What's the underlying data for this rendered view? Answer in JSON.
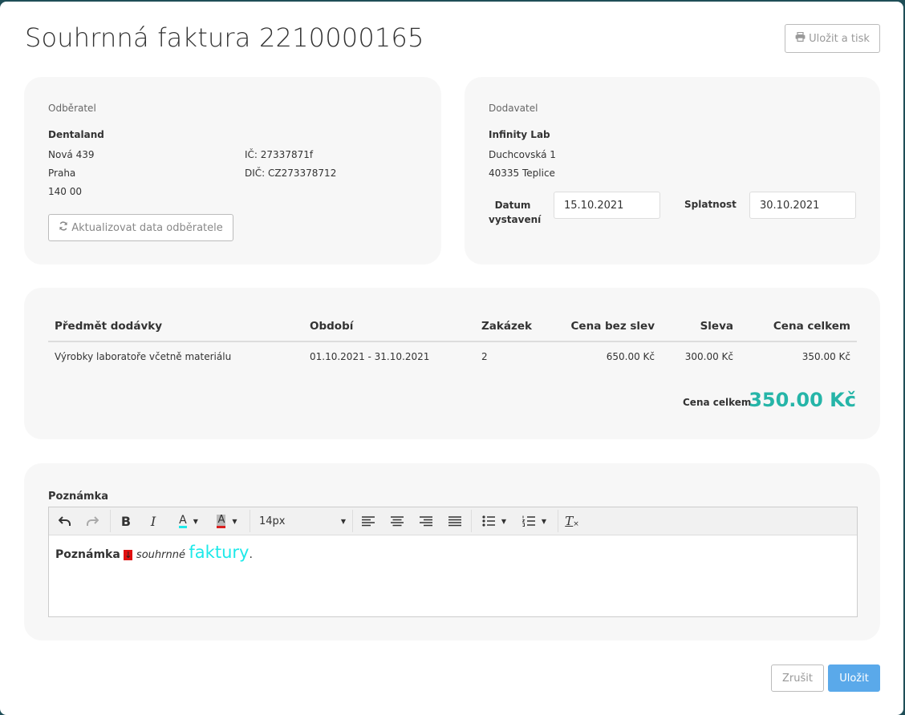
{
  "title": "Souhrnná faktura 2210000165",
  "header": {
    "print_save_label": "Uložit a tisk",
    "print_icon": "print-icon"
  },
  "customer": {
    "heading": "Odběratel",
    "name": "Dentaland",
    "street": "Nová 439",
    "city": "Praha",
    "zip": "140 00",
    "ic": "IČ: 27337871f",
    "dic": "DIČ: CZ273378712",
    "refresh_label": "Aktualizovat data odběratele",
    "refresh_icon": "refresh-icon"
  },
  "supplier": {
    "heading": "Dodavatel",
    "name": "Infinity Lab",
    "street": "Duchcovská 1",
    "city": "40335 Teplice",
    "issue_date_label_1": "Datum",
    "issue_date_label_2": "vystavení",
    "issue_date": "15.10.2021",
    "due_date_label": "Splatnost",
    "due_date": "30.10.2021"
  },
  "items": {
    "columns": [
      "Předmět dodávky",
      "Období",
      "Zakázek",
      "Cena bez slev",
      "Sleva",
      "Cena celkem"
    ],
    "rows": [
      [
        "Výrobky laboratoře včetně materiálu",
        "01.10.2021 - 31.10.2021",
        "2",
        "650.00 Kč",
        "300.00 Kč",
        "350.00 Kč"
      ]
    ],
    "total_label": "Cena celkem",
    "total_value": "350.00 Kč"
  },
  "note": {
    "label": "Poznámka",
    "font_size": "14px",
    "content": {
      "bold": "Poznámka",
      "marker": "↓",
      "italic": "souhrnné",
      "cyan": "faktury",
      "end": "."
    }
  },
  "footer": {
    "cancel_label": "Zrušit",
    "save_label": "Uložit"
  },
  "colors": {
    "accent": "#26b5a8",
    "primary": "#5aa9ea",
    "cyan_text": "#1de9e9"
  }
}
